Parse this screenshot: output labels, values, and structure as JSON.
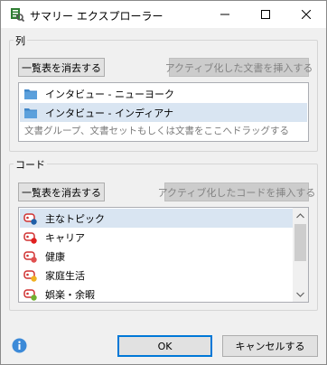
{
  "window": {
    "title": "サマリー エクスプローラー",
    "minimize_icon": "minimize-icon",
    "maximize_icon": "maximize-icon",
    "close_icon": "close-icon",
    "app_icon": "summary-explorer-app-icon"
  },
  "columns": {
    "legend": "列",
    "clear_button": "一覧表を消去する",
    "insert_button": "アクティブ化した文書を挿入する",
    "items": [
      {
        "label": "インタビュー - ニューヨーク",
        "icon": "folder-icon",
        "selected": false
      },
      {
        "label": "インタビュー - インディアナ",
        "icon": "folder-icon",
        "selected": true
      }
    ],
    "hint": "文書グループ、文書セットもしくは文書をここへドラッグする"
  },
  "codes": {
    "legend": "コード",
    "clear_button": "一覧表を消去する",
    "insert_button": "アクティブ化したコードを挿入する",
    "items": [
      {
        "label": "主なトピック",
        "icon": "code-tag-icon",
        "color": "#1f5fa8",
        "selected": true
      },
      {
        "label": "キャリア",
        "icon": "code-tag-icon",
        "color": "#e02020",
        "selected": false
      },
      {
        "label": "健康",
        "icon": "code-tag-icon",
        "color": "#e05050",
        "selected": false
      },
      {
        "label": "家庭生活",
        "icon": "code-tag-icon",
        "color": "#f0b020",
        "selected": false
      },
      {
        "label": "娯楽・余暇",
        "icon": "code-tag-icon",
        "color": "#70b030",
        "selected": false
      }
    ]
  },
  "footer": {
    "info_icon": "info-icon",
    "ok_button": "OK",
    "cancel_button": "キャンセルする"
  },
  "colors": {
    "selection": "#d9e5f2",
    "accent": "#0078d7",
    "info": "#3c8ad8"
  }
}
